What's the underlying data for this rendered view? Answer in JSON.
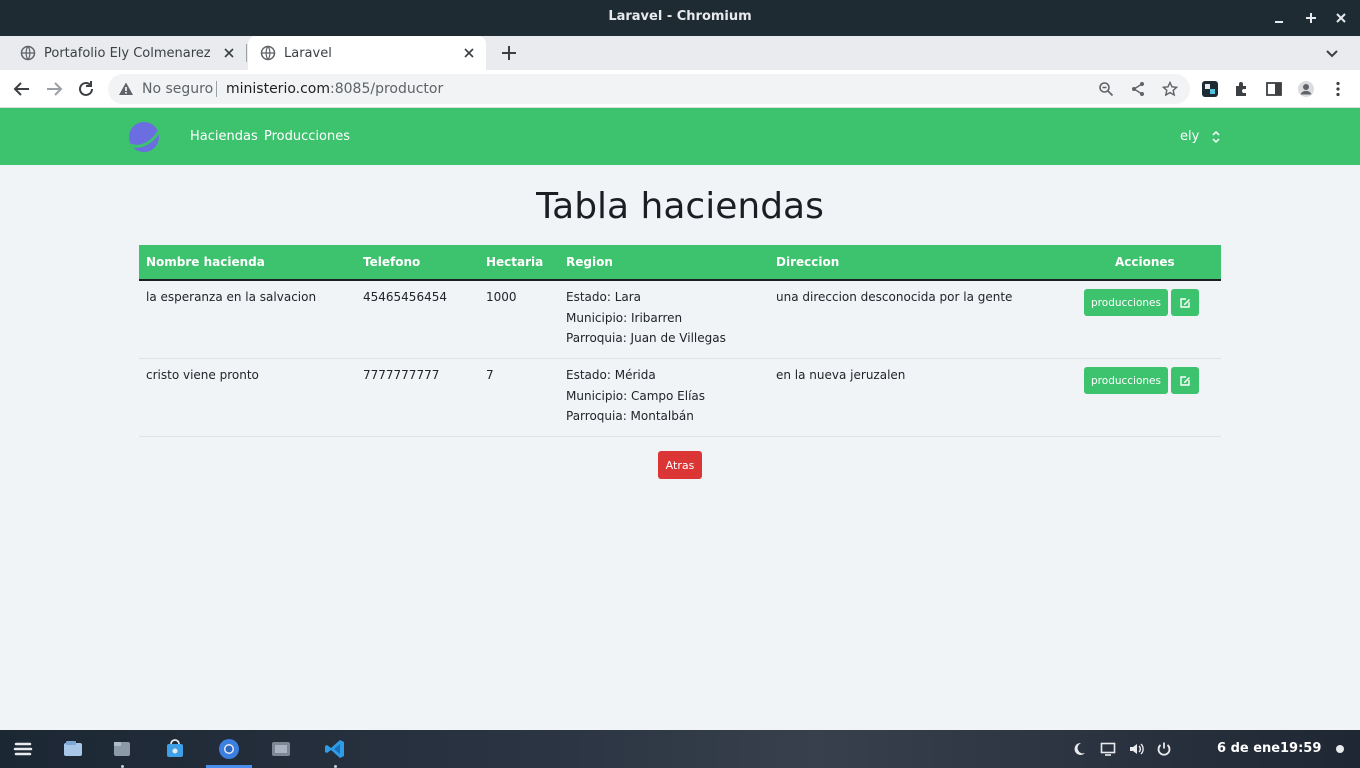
{
  "window": {
    "title": "Laravel - Chromium"
  },
  "tabs": [
    {
      "label": "Portafolio Ely Colmenarez",
      "icon": "globe-icon"
    },
    {
      "label": "Laravel",
      "icon": "globe-icon",
      "active": true
    }
  ],
  "omnibox": {
    "security_label": "No seguro",
    "url_host": "ministerio.com",
    "url_rest": ":8085/productor"
  },
  "app": {
    "nav_links": [
      "Haciendas",
      "Producciones"
    ],
    "user": "ely",
    "colors": {
      "primary": "#3dc26e",
      "danger": "#dc3535"
    }
  },
  "page": {
    "title": "Tabla haciendas",
    "back_label": "Atras"
  },
  "table": {
    "columns": [
      "Nombre hacienda",
      "Telefono",
      "Hectaria",
      "Region",
      "Direccion",
      "Acciones"
    ],
    "rows": [
      {
        "nombre": "la esperanza en la salvacion",
        "telefono": "45465456454",
        "hectaria": "1000",
        "region": [
          "Estado: Lara",
          "Municipio: Iribarren",
          "Parroquia: Juan de Villegas"
        ],
        "direccion": "una direccion desconocida por la gente",
        "action_label": "producciones"
      },
      {
        "nombre": "cristo viene pronto",
        "telefono": "7777777777",
        "hectaria": "7",
        "region": [
          "Estado: Mérida",
          "Municipio: Campo Elías",
          "Parroquia: Montalbán"
        ],
        "direccion": "en la nueva jeruzalen",
        "action_label": "producciones"
      }
    ]
  },
  "taskbar": {
    "apps": [
      "zorin-menu-icon",
      "files-icon",
      "file-manager-icon",
      "software-store-icon",
      "chromium-icon",
      "screenshot-icon",
      "vscode-icon"
    ],
    "date": "6 de ene",
    "time": "19:59"
  }
}
